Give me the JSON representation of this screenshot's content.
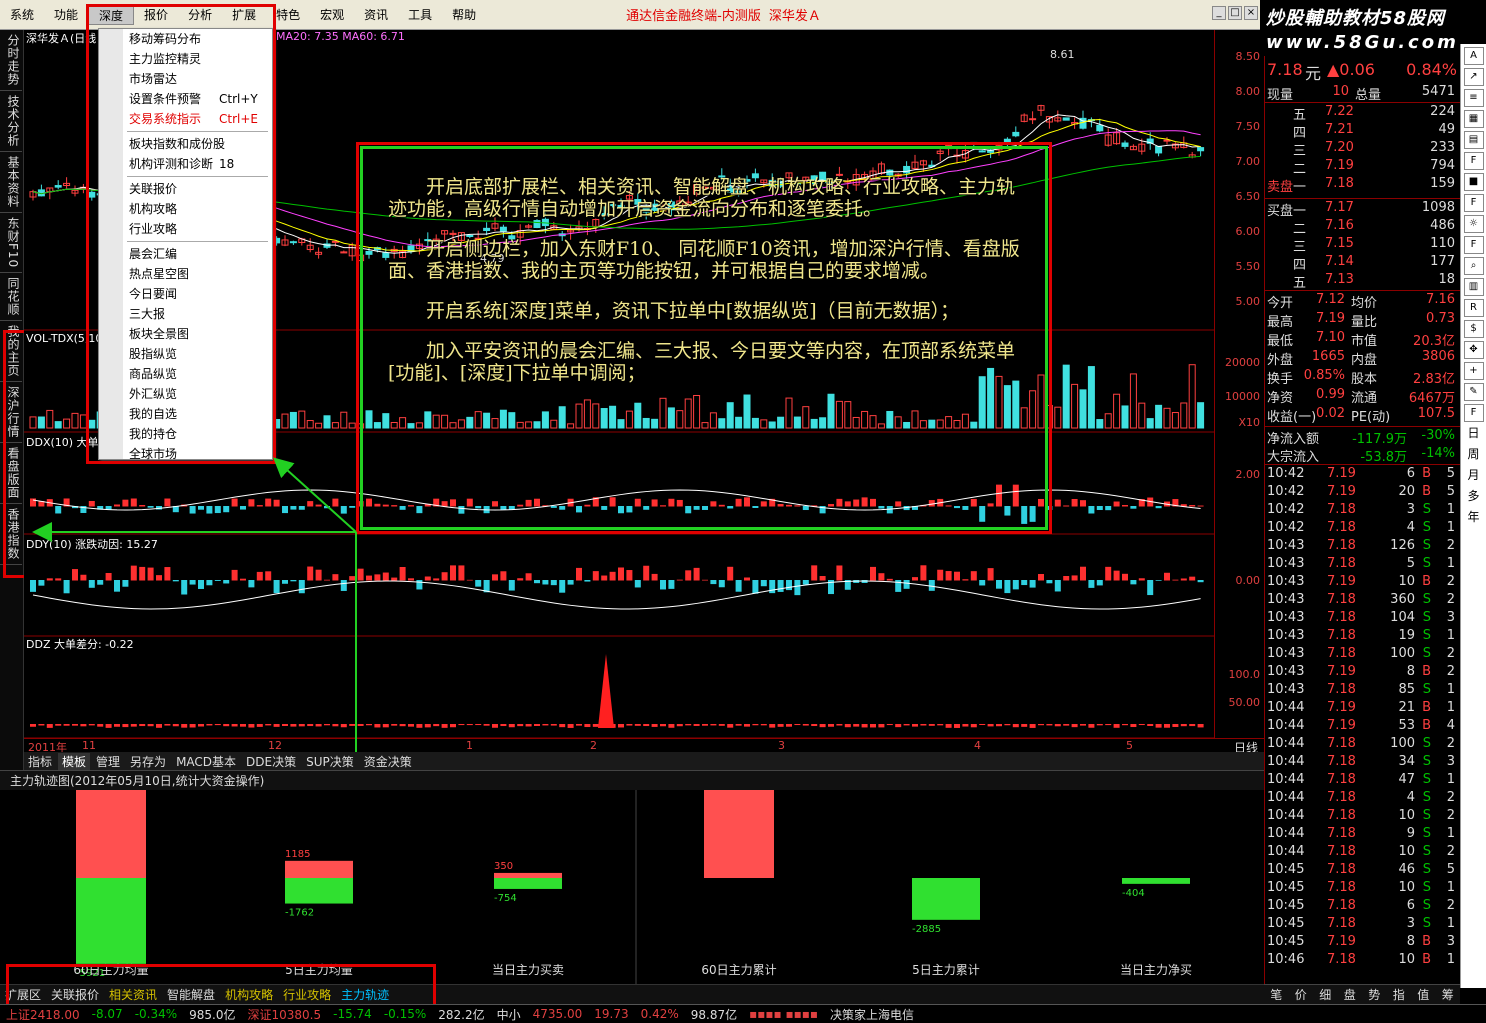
{
  "menubar": {
    "items": [
      "系统",
      "功能",
      "深度",
      "报价",
      "分析",
      "扩展",
      "特色",
      "宏观",
      "资讯",
      "工具",
      "帮助"
    ],
    "title": "通达信金融终端-内测版",
    "stock": "深华发Ａ"
  },
  "brand": {
    "line1": "炒股輔助教材58股网",
    "line2": "www.58Gu.com"
  },
  "left_tabs": [
    "分时走势",
    "技术分析",
    "基本资料",
    "东财F10",
    "同花顺",
    "我的主页",
    "深沪行情",
    "看盘版面",
    "香港指数"
  ],
  "chart": {
    "header": "深华发Ａ(日线",
    "ma_text": "MA20: 7.35  MA60: 6.71",
    "price_high_label": "8.61",
    "price_low_label": "4.79",
    "vol_text": "VOL-TDX(5,10  71.00  MAVOL1: 20052.80",
    "ddx_text": "DDX(10)  大单",
    "ddy_text": "DDY(10)  涨跌动因: 15.27",
    "ddz_text": "DDZ  大单差分: -0.22",
    "price_axis": [
      "8.50",
      "8.00",
      "7.50",
      "7.00",
      "6.50",
      "6.00",
      "5.50",
      "5.00"
    ],
    "vol_axis": [
      "20000",
      "10000",
      "X10"
    ],
    "ddx_axis": [
      "2.00"
    ],
    "ddy_axis": [
      "0.00"
    ],
    "ddz_axis": [
      "100.0",
      "50.00"
    ],
    "date_labels": [
      "2011年",
      "11",
      "12",
      "1",
      "2",
      "3",
      "4",
      "5"
    ],
    "period": "日线"
  },
  "dropdown": {
    "items": [
      {
        "label": "移动筹码分布",
        "shortcut": ""
      },
      {
        "label": "主力监控精灵",
        "shortcut": ""
      },
      {
        "label": "市场雷达",
        "shortcut": ""
      },
      {
        "label": "设置条件预警",
        "shortcut": "Ctrl+Y"
      },
      {
        "label": "交易系统指示",
        "shortcut": "Ctrl+E",
        "highlight": true
      },
      {
        "sep": true
      },
      {
        "label": "板块指数和成份股",
        "shortcut": ""
      },
      {
        "label": "机构评测和诊断",
        "shortcut": "18"
      },
      {
        "sep": true
      },
      {
        "label": "关联报价",
        "shortcut": ""
      },
      {
        "label": "机构攻略",
        "shortcut": ""
      },
      {
        "label": "行业攻略",
        "shortcut": ""
      },
      {
        "sep": true
      },
      {
        "label": "晨会汇编",
        "shortcut": ""
      },
      {
        "label": "热点星空图",
        "shortcut": ""
      },
      {
        "label": "今日要闻",
        "shortcut": ""
      },
      {
        "label": "三大报",
        "shortcut": ""
      },
      {
        "label": "板块全景图",
        "shortcut": ""
      },
      {
        "label": "股指纵览",
        "shortcut": ""
      },
      {
        "label": "商品纵览",
        "shortcut": ""
      },
      {
        "label": "外汇纵览",
        "shortcut": ""
      },
      {
        "label": "我的自选",
        "shortcut": ""
      },
      {
        "label": "我的持仓",
        "shortcut": ""
      },
      {
        "label": "全球市场",
        "shortcut": ""
      }
    ]
  },
  "annotation": {
    "p1": "开启底部扩展栏、相关资讯、智能解盘、机构攻略、行业攻略、主力轨迹功能，高级行情自动增加开启资金流向分布和逐笔委托。",
    "p2": "开启侧边栏，加入东财F10、 同花顺F10资讯，增加深沪行情、看盘版面、香港指数、我的主页等功能按钮，并可根据自己的要求增减。",
    "p3": "开启系统[深度]菜单，资讯下拉单中[数据纵览]（目前无数据）；",
    "p4": "加入平安资讯的晨会汇编、三大报、今日要文等内容，在顶部系统菜单[功能]、[深度]下拉单中调阅；"
  },
  "tabstrip": [
    "指标",
    "模板",
    "管理",
    "另存为",
    "MACD基本",
    "DDE决策",
    "SUP决策",
    "资金决策"
  ],
  "panel": {
    "title": "主力轨迹图(2012年05月10日,统计大资金操作)",
    "bars": [
      {
        "label": "60日主力均量",
        "pos": 6083,
        "neg": -5921
      },
      {
        "label": "5日主力均量",
        "pos": 1185,
        "neg": -1762
      },
      {
        "label": "当日主力买卖",
        "pos": 350,
        "neg": -754
      },
      {
        "label": "60日主力累计",
        "pos": 9688,
        "neg": null
      },
      {
        "label": "5日主力累计",
        "pos": null,
        "neg": -2885
      },
      {
        "label": "当日主力净买",
        "pos": null,
        "neg": -404
      }
    ]
  },
  "bottom_tabs": [
    {
      "label": "扩展区",
      "style": ""
    },
    {
      "label": "关联报价",
      "style": ""
    },
    {
      "label": "相关资讯",
      "style": "y"
    },
    {
      "label": "智能解盘",
      "style": ""
    },
    {
      "label": "机构攻略",
      "style": "y"
    },
    {
      "label": "行业攻略",
      "style": "y"
    },
    {
      "label": "主力轨迹",
      "style": "c"
    }
  ],
  "status": {
    "sh": "上证2418.00",
    "sh_chg": "-8.07",
    "sh_pct": "-0.34%",
    "sh_amt": "985.0亿",
    "sz": "深证10380.5",
    "sz_chg": "-15.74",
    "sz_pct": "-0.15%",
    "sz_amt": "282.2亿",
    "zx_label": "中小",
    "zx_val": "4735.00",
    "zx_chg": "19.73",
    "zx_pct": "0.42%",
    "zx_amt": "98.87亿",
    "ticker": "决策家上海电信"
  },
  "quote": {
    "price": "7.18",
    "unit": "元",
    "change": "▲0.06",
    "pct": "0.84%",
    "xianliang_label": "现量",
    "xianliang": "10",
    "zongliang_label": "总量",
    "zongliang": "5471",
    "sell_label": "卖盘",
    "buy_label": "买盘",
    "asks": [
      {
        "lvl": "五",
        "price": "7.22",
        "vol": "224"
      },
      {
        "lvl": "四",
        "price": "7.21",
        "vol": "49"
      },
      {
        "lvl": "三",
        "price": "7.20",
        "vol": "233"
      },
      {
        "lvl": "二",
        "price": "7.19",
        "vol": "794"
      },
      {
        "lvl": "一",
        "price": "7.18",
        "vol": "159"
      }
    ],
    "bids": [
      {
        "lvl": "一",
        "price": "7.17",
        "vol": "1098"
      },
      {
        "lvl": "二",
        "price": "7.16",
        "vol": "486"
      },
      {
        "lvl": "三",
        "price": "7.15",
        "vol": "110"
      },
      {
        "lvl": "四",
        "price": "7.14",
        "vol": "177"
      },
      {
        "lvl": "五",
        "price": "7.13",
        "vol": "18"
      }
    ],
    "stats": [
      [
        "今开",
        "7.12",
        "均价",
        "7.16"
      ],
      [
        "最高",
        "7.19",
        "量比",
        "0.73"
      ],
      [
        "最低",
        "7.10",
        "市值",
        "20.3亿"
      ],
      [
        "外盘",
        "1665",
        "内盘",
        "3806"
      ],
      [
        "换手",
        "0.85%",
        "股本",
        "2.83亿"
      ],
      [
        "净资",
        "0.99",
        "流通",
        "6467万"
      ],
      [
        "收益(一)",
        "0.02",
        "PE(动)",
        "107.5"
      ]
    ],
    "flow": [
      [
        "净流入额",
        "-117.9万",
        "-30%"
      ],
      [
        "大宗流入",
        "-53.8万",
        "-14%"
      ]
    ],
    "ticks": [
      [
        "10:42",
        "7.19",
        "6",
        "B",
        "5"
      ],
      [
        "10:42",
        "7.19",
        "20",
        "B",
        "5"
      ],
      [
        "10:42",
        "7.18",
        "3",
        "S",
        "1"
      ],
      [
        "10:42",
        "7.18",
        "4",
        "S",
        "1"
      ],
      [
        "10:43",
        "7.18",
        "126",
        "S",
        "2"
      ],
      [
        "10:43",
        "7.18",
        "5",
        "S",
        "1"
      ],
      [
        "10:43",
        "7.19",
        "10",
        "B",
        "2"
      ],
      [
        "10:43",
        "7.18",
        "360",
        "S",
        "2"
      ],
      [
        "10:43",
        "7.18",
        "104",
        "S",
        "3"
      ],
      [
        "10:43",
        "7.18",
        "19",
        "S",
        "1"
      ],
      [
        "10:43",
        "7.18",
        "100",
        "S",
        "2"
      ],
      [
        "10:43",
        "7.19",
        "8",
        "B",
        "2"
      ],
      [
        "10:43",
        "7.18",
        "85",
        "S",
        "1"
      ],
      [
        "10:44",
        "7.19",
        "21",
        "B",
        "1"
      ],
      [
        "10:44",
        "7.19",
        "53",
        "B",
        "4"
      ],
      [
        "10:44",
        "7.18",
        "100",
        "S",
        "2"
      ],
      [
        "10:44",
        "7.18",
        "34",
        "S",
        "3"
      ],
      [
        "10:44",
        "7.18",
        "47",
        "S",
        "1"
      ],
      [
        "10:44",
        "7.18",
        "4",
        "S",
        "2"
      ],
      [
        "10:44",
        "7.18",
        "10",
        "S",
        "2"
      ],
      [
        "10:44",
        "7.18",
        "9",
        "S",
        "1"
      ],
      [
        "10:44",
        "7.18",
        "10",
        "S",
        "2"
      ],
      [
        "10:45",
        "7.18",
        "46",
        "S",
        "5"
      ],
      [
        "10:45",
        "7.18",
        "10",
        "S",
        "1"
      ],
      [
        "10:45",
        "7.18",
        "6",
        "S",
        "2"
      ],
      [
        "10:45",
        "7.18",
        "3",
        "S",
        "1"
      ],
      [
        "10:45",
        "7.19",
        "8",
        "B",
        "3"
      ],
      [
        "10:46",
        "7.18",
        "10",
        "B",
        "1"
      ]
    ]
  },
  "right_bottom_tabs": [
    "笔",
    "价",
    "细",
    "盘",
    "势",
    "指",
    "值",
    "筹"
  ],
  "tool_col": [
    "日",
    "周",
    "月",
    "多",
    "年"
  ]
}
